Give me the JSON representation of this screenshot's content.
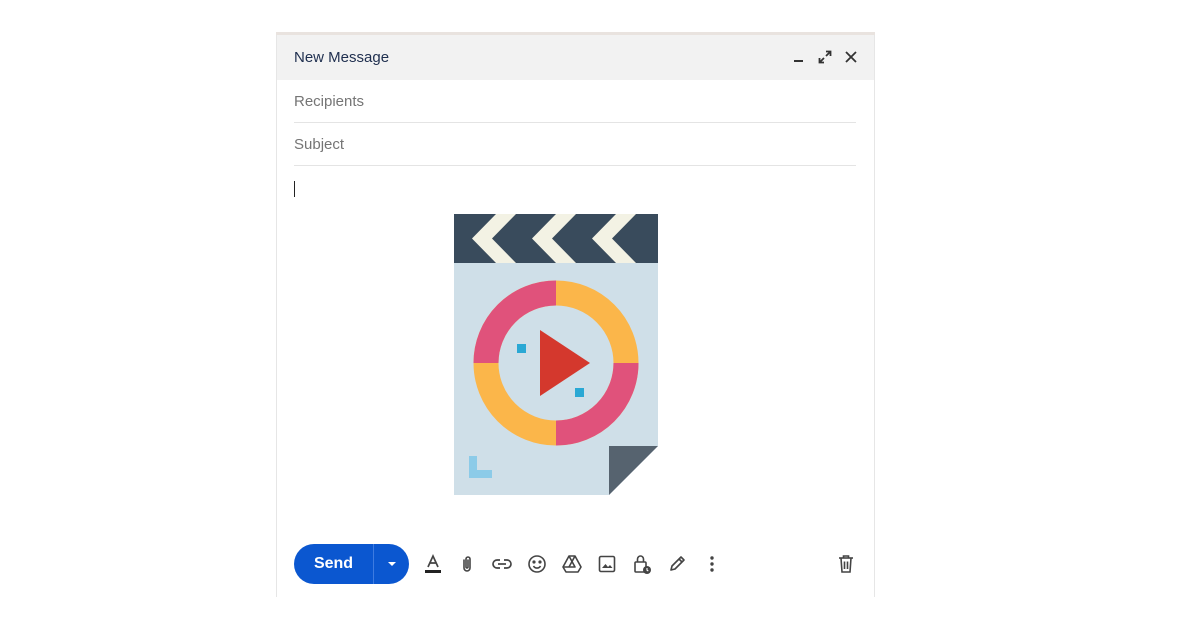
{
  "compose": {
    "title": "New Message",
    "recipients_placeholder": "Recipients",
    "subject_placeholder": "Subject",
    "send_label": "Send"
  },
  "icons": {
    "header": [
      "minimize-icon",
      "expand-icon",
      "close-icon"
    ],
    "toolbar": [
      "formatting-icon",
      "attach-icon",
      "link-icon",
      "emoji-icon",
      "drive-icon",
      "photo-icon",
      "confidential-icon",
      "signature-icon",
      "more-options-icon",
      "trash-icon"
    ]
  },
  "colors": {
    "send_button": "#0b57d0",
    "header_bg": "#f2f2f2",
    "title_text": "#1f2f4f"
  }
}
